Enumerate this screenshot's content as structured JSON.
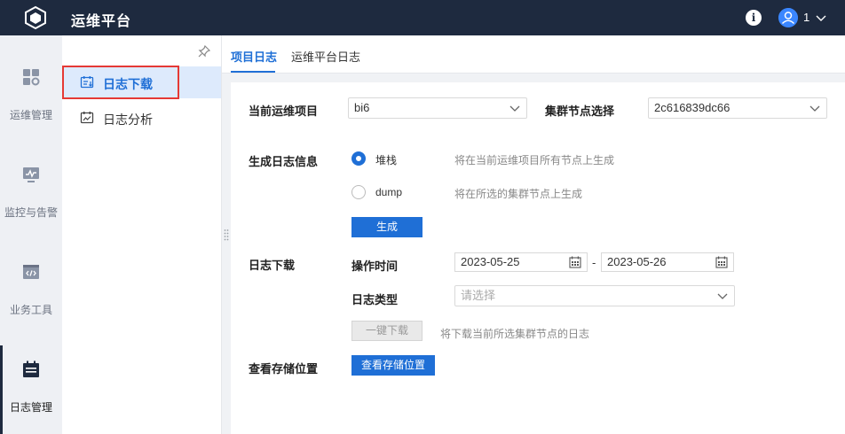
{
  "header": {
    "title": "运维平台",
    "user": "1",
    "info_glyph": "i"
  },
  "rail": {
    "items": [
      {
        "label": "运维管理",
        "icon": "grid-gear-icon"
      },
      {
        "label": "监控与告警",
        "icon": "monitor-icon"
      },
      {
        "label": "业务工具",
        "icon": "code-window-icon"
      },
      {
        "label": "日志管理",
        "icon": "calendar-log-icon",
        "active": true
      }
    ]
  },
  "submenu": {
    "items": [
      {
        "label": "日志下载",
        "icon": "log-download-icon",
        "active": true
      },
      {
        "label": "日志分析",
        "icon": "log-analysis-icon"
      }
    ]
  },
  "tabs": [
    {
      "label": "项目日志",
      "active": true
    },
    {
      "label": "运维平台日志"
    }
  ],
  "form": {
    "project_label": "当前运维项目",
    "project_value": "bi6",
    "node_label": "集群节点选择",
    "node_value": "2c616839dc66",
    "gen_label": "生成日志信息",
    "radio_stack": "堆栈",
    "radio_stack_hint": "将在当前运维项目所有节点上生成",
    "radio_dump": "dump",
    "radio_dump_hint": "将在所选的集群节点上生成",
    "generate_button": "生成",
    "download_label": "日志下载",
    "op_time_label": "操作时间",
    "date_start": "2023-05-25",
    "date_sep": "-",
    "date_end": "2023-05-26",
    "log_type_label": "日志类型",
    "log_type_placeholder": "请选择",
    "oneclick_button": "一键下载",
    "oneclick_hint": "将下载当前所选集群节点的日志",
    "storage_label": "查看存储位置",
    "storage_button": "查看存储位置"
  },
  "colors": {
    "header_bg": "#1e2a3f",
    "accent": "#1f6fd6",
    "highlight_border": "#e53935"
  }
}
